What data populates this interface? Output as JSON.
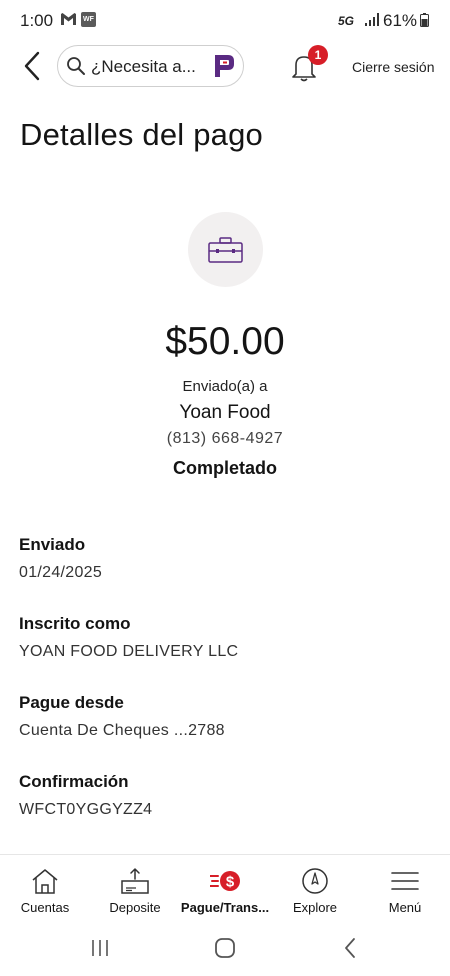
{
  "status_bar": {
    "time": "1:00",
    "network": "5G",
    "battery": "61%",
    "app_badge": "WF"
  },
  "header": {
    "search_text": "¿Necesita a...",
    "notification_count": "1",
    "logout_label": "Cierre sesión"
  },
  "page": {
    "title": "Detalles del pago"
  },
  "payment": {
    "amount": "$50.00",
    "sent_to_label": "Enviado(a) a",
    "recipient": "Yoan Food",
    "phone": "(813) 668-4927",
    "status": "Completado"
  },
  "details": [
    {
      "label": "Enviado",
      "value": "01/24/2025"
    },
    {
      "label": "Inscrito como",
      "value": "YOAN FOOD DELIVERY LLC"
    },
    {
      "label": "Pague desde",
      "value": "Cuenta De Cheques ...2788"
    },
    {
      "label": "Confirmación",
      "value": "WFCT0YGGYZZ4"
    }
  ],
  "tabs": [
    {
      "label": "Cuentas",
      "icon": "home-icon"
    },
    {
      "label": "Deposite",
      "icon": "deposit-icon"
    },
    {
      "label": "Pague/Trans...",
      "icon": "pay-transfer-icon"
    },
    {
      "label": "Explore",
      "icon": "compass-icon"
    },
    {
      "label": "Menú",
      "icon": "menu-icon"
    }
  ],
  "colors": {
    "brand_red": "#d71e28",
    "accent_purple": "#5a2a82",
    "icon_circle_bg": "#f2f0f0"
  }
}
